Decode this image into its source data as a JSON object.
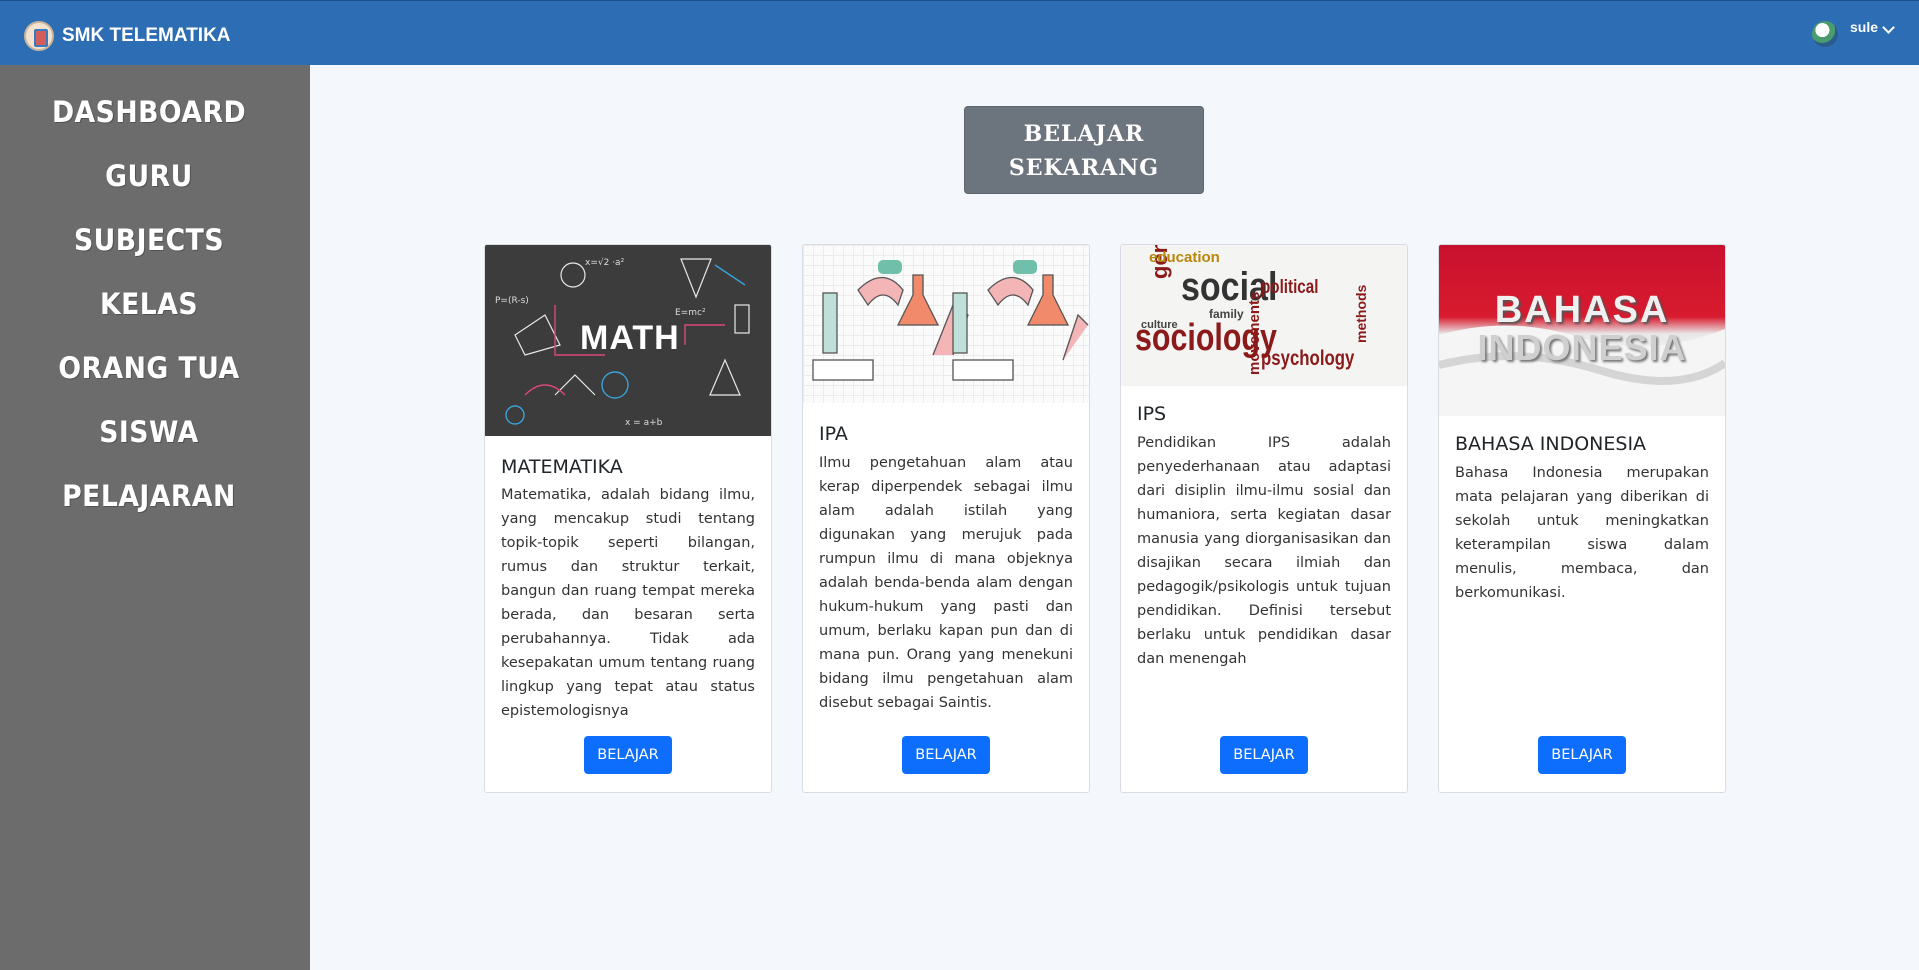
{
  "header": {
    "brand": "SMK TELEMATIKA",
    "user": "sule"
  },
  "sidebar": {
    "items": [
      {
        "label": "DASHBOARD"
      },
      {
        "label": "GURU"
      },
      {
        "label": "SUBJECTS"
      },
      {
        "label": "KELAS"
      },
      {
        "label": "ORANG TUA"
      },
      {
        "label": "SISWA"
      },
      {
        "label": "PELAJARAN"
      }
    ]
  },
  "main": {
    "cta_line1": "BELAJAR",
    "cta_line2": "SEKARANG",
    "cards": [
      {
        "title": "MATEMATIKA",
        "image_text": "MATH",
        "description": "Matematika, adalah bidang ilmu, yang mencakup studi tentang topik-topik seperti bilangan, rumus dan struktur terkait, bangun dan ruang tempat mereka berada, dan besaran serta perubahannya. Tidak ada kesepakatan umum tentang ruang lingkup yang tepat atau status epistemologisnya",
        "button": "BELAJAR"
      },
      {
        "title": "IPA",
        "description": "Ilmu pengetahuan alam atau kerap diperpendek sebagai ilmu alam adalah istilah yang digunakan yang merujuk pada rumpun ilmu di mana objeknya adalah benda-benda alam dengan hukum-hukum yang pasti dan umum, berlaku kapan pun dan di mana pun. Orang yang menekuni bidang ilmu pengetahuan alam disebut sebagai Saintis.",
        "button": "BELAJAR"
      },
      {
        "title": "IPS",
        "image_words": [
          "social",
          "sociology",
          "gender",
          "psychology",
          "political",
          "movements",
          "education",
          "culture",
          "family",
          "methods"
        ],
        "description": "Pendidikan IPS adalah penyederhanaan atau adaptasi dari disiplin ilmu-ilmu sosial dan humaniora, serta kegiatan dasar manusia yang diorganisasikan dan disajikan secara ilmiah dan pedagogik/psikologis untuk tujuan pendidikan. Definisi tersebut berlaku untuk pendidikan dasar dan menengah",
        "button": "BELAJAR"
      },
      {
        "title": "BAHASA INDONESIA",
        "image_text_1": "BAHASA",
        "image_text_2": "INDONESIA",
        "description": "Bahasa Indonesia merupakan mata pelajaran yang diberikan di sekolah untuk meningkatkan keterampilan siswa dalam menulis, membaca, dan berkomunikasi.",
        "button": "BELAJAR"
      }
    ]
  },
  "colors": {
    "topbar": "#2d6db4",
    "sidebar": "#6c6c6c",
    "cta": "#6c757d",
    "button": "#0d6efd",
    "background": "#f4f7fb"
  }
}
